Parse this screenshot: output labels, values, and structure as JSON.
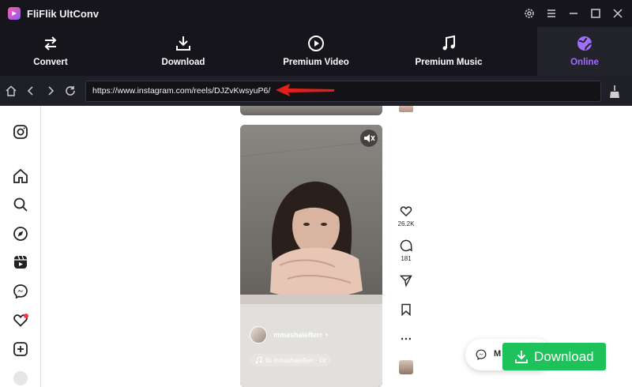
{
  "app": {
    "title": "FliFlik UltConv"
  },
  "tabs": [
    {
      "label": "Convert",
      "icon": "convert-arrows-icon"
    },
    {
      "label": "Download",
      "icon": "download-icon"
    },
    {
      "label": "Premium Video",
      "icon": "play-circle-icon"
    },
    {
      "label": "Premium Music",
      "icon": "music-note-icon"
    },
    {
      "label": "Online",
      "icon": "globe-icon",
      "active": true
    }
  ],
  "browser": {
    "url": "https://www.instagram.com/reels/DJZvKwsyuP6/"
  },
  "reel": {
    "username": "mmashalefterr",
    "username_sep": "•",
    "audio": "lio   mmashalefterr · Or",
    "likes": "26.2K",
    "comments": "181"
  },
  "floating": {
    "messages_label": "M",
    "download_label": "Download"
  },
  "colors": {
    "accent": "#a06dff",
    "download": "#1ec25a",
    "arrow": "#e0201b"
  }
}
